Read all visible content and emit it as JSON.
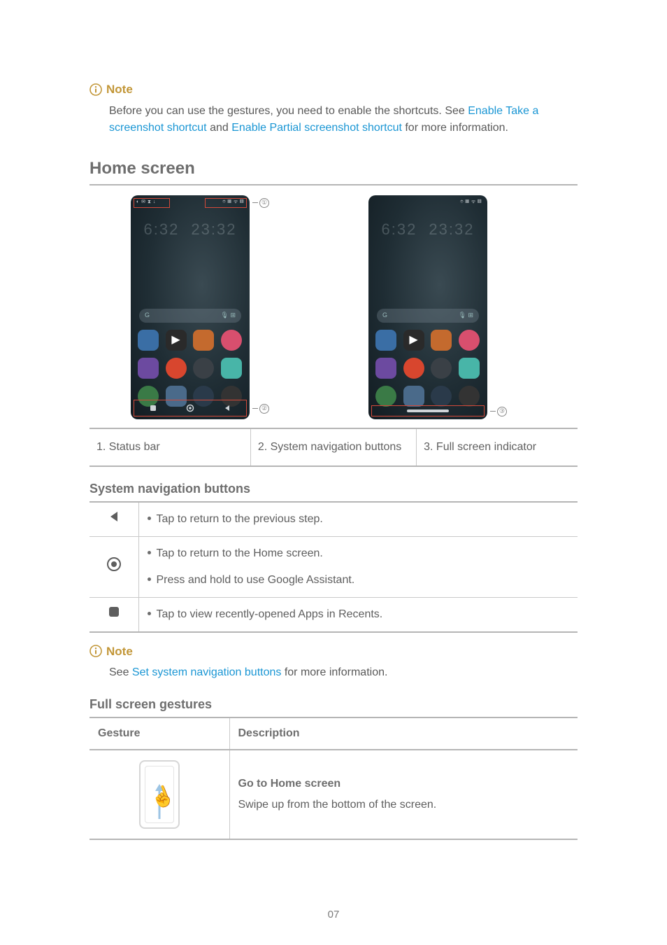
{
  "note1": {
    "label": "Note",
    "text_before": "Before you can use the gestures, you need to enable the shortcuts. See ",
    "link1": "Enable Take a screenshot shortcut",
    "mid": " and ",
    "link2": "Enable Partial screenshot shortcut",
    "text_after": " for more information."
  },
  "section_home": "Home screen",
  "callouts": {
    "c1": "①",
    "c2": "②",
    "c3": "③"
  },
  "legend": {
    "c1": "1. Status bar",
    "c2": "2. System navigation buttons",
    "c3": "3. Full screen indicator"
  },
  "subsection_nav": "System navigation buttons",
  "nav_rows": {
    "back": "Tap to return to the previous step.",
    "home1": "Tap to return to the Home screen.",
    "home2": "Press and hold to use Google Assistant.",
    "recents": "Tap to view recently-opened Apps in Recents."
  },
  "note2": {
    "label": "Note",
    "pre": "See ",
    "link": "Set system navigation buttons",
    "post": " for more information."
  },
  "subsection_gestures": "Full screen gestures",
  "gesture_table": {
    "h1": "Gesture",
    "h2": "Description",
    "row1_title": "Go to Home screen",
    "row1_desc": "Swipe up from the bottom of the screen."
  },
  "page_number": "07"
}
